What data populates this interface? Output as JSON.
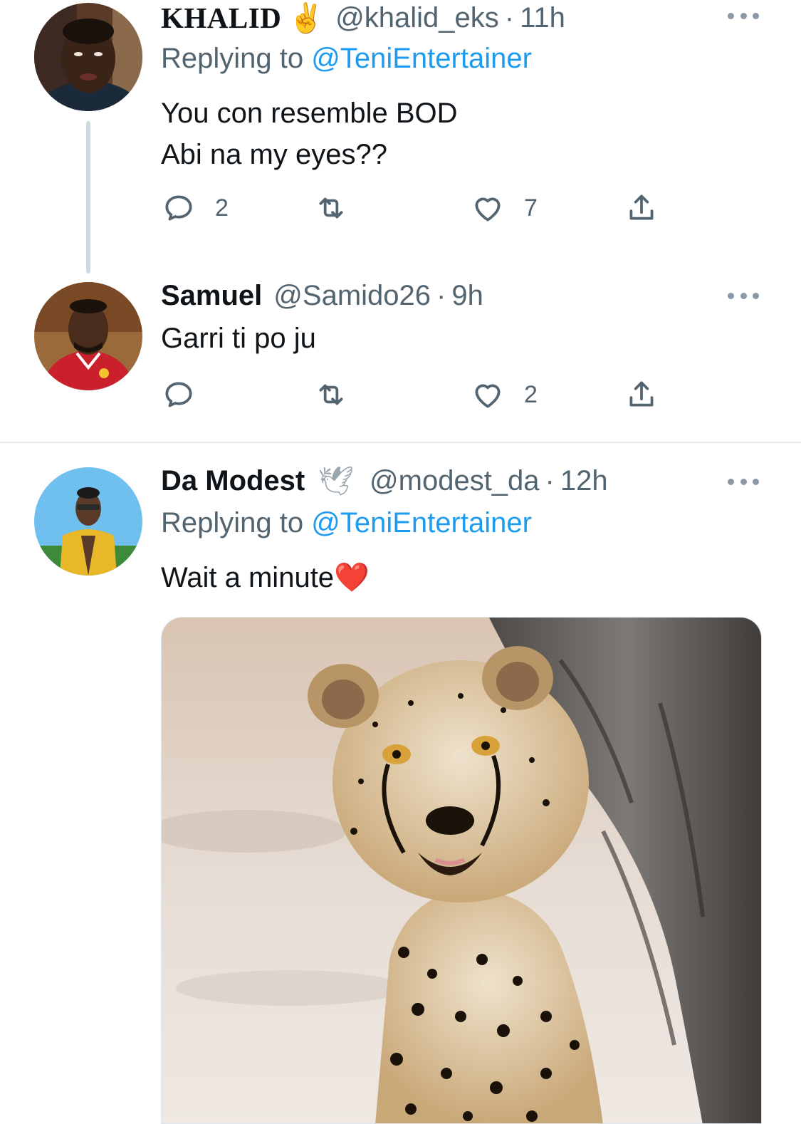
{
  "colors": {
    "link": "#1d9bf0",
    "secondary_text": "#536471",
    "primary_text": "#0f1419",
    "thread_line": "#cfd9de"
  },
  "tweets": [
    {
      "name": "KHALID",
      "badge_icon": "victory-hand-emoji",
      "badge": "✌",
      "handle": "@khalid_eks",
      "sep": "·",
      "time": "11h",
      "replying_prefix": "Replying to",
      "replying_to": "@TeniEntertainer",
      "text_lines": [
        "You con resemble BOD",
        "Abi na my eyes??"
      ],
      "reply_count": "2",
      "retweet_count": "",
      "like_count": "7"
    },
    {
      "name": "Samuel",
      "handle": "@Samido26",
      "sep": "·",
      "time": "9h",
      "text_lines": [
        "Garri ti po ju"
      ],
      "reply_count": "",
      "retweet_count": "",
      "like_count": "2"
    },
    {
      "name": "Da Modest",
      "badge_icon": "dove-emoji",
      "badge": "🕊",
      "handle": "@modest_da",
      "sep": "·",
      "time": "12h",
      "replying_prefix": "Replying to",
      "replying_to": "@TeniEntertainer",
      "text_lines": [
        "Wait a minute"
      ],
      "text_emoji": "❤️",
      "media_icon": "cheetah-photo"
    }
  ]
}
